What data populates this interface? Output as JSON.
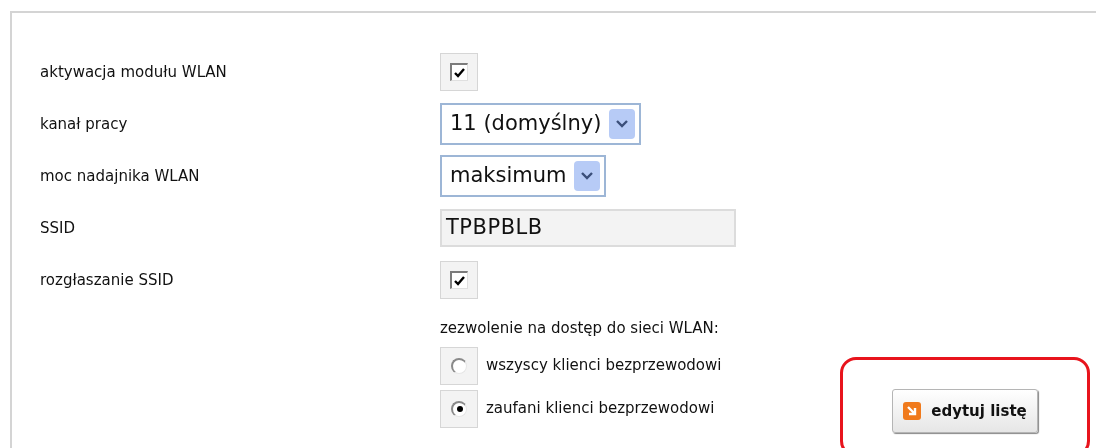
{
  "settings": [
    {
      "kind": "checkbox",
      "label": "aktywacja modułu WLAN",
      "checked": true
    },
    {
      "kind": "select",
      "label": "kanał pracy",
      "value": "11 (domyślny)"
    },
    {
      "kind": "select",
      "label": "moc nadajnika WLAN",
      "value": "maksimum"
    },
    {
      "kind": "text",
      "label": "SSID",
      "value": "TPBPBLB"
    },
    {
      "kind": "checkbox",
      "label": "rozgłaszanie SSID",
      "checked": true
    }
  ],
  "access": {
    "label": "zezwolenie na dostęp do sieci WLAN:",
    "options": [
      {
        "label": "wszyscy klienci bezprzewodowi",
        "selected": false
      },
      {
        "label": "zaufani klienci bezprzewodowi",
        "selected": true
      }
    ]
  },
  "edit_button": {
    "label": "edytuj listę"
  }
}
